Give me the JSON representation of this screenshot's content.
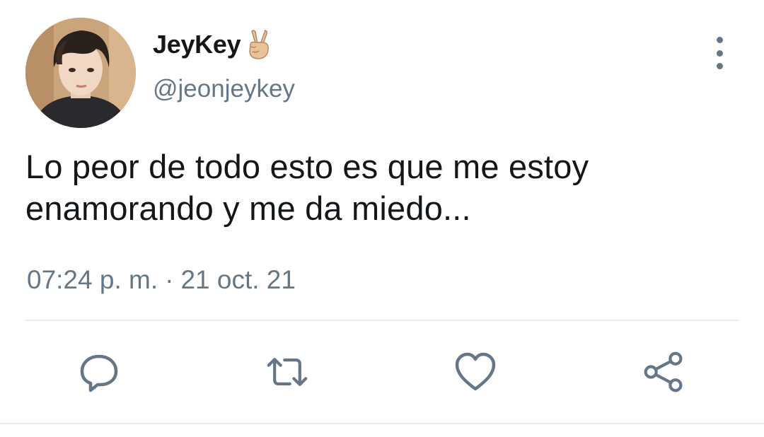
{
  "tweet": {
    "display_name": "JeyKey",
    "name_emoji": "victory-hand-emoji",
    "handle": "@jeonjeykey",
    "text": "Lo peor de todo esto es que me estoy\nenamorando y me da miedo...",
    "time": "07:24 p. m.",
    "separator": "·",
    "date": "21 oct. 21"
  },
  "actions": {
    "icons": [
      "reply-icon",
      "retweet-icon",
      "like-icon",
      "share-icon"
    ]
  },
  "colors": {
    "text_primary": "#14171a",
    "text_secondary": "#657786",
    "divider": "#e6ecf0",
    "icon": "#657786"
  }
}
